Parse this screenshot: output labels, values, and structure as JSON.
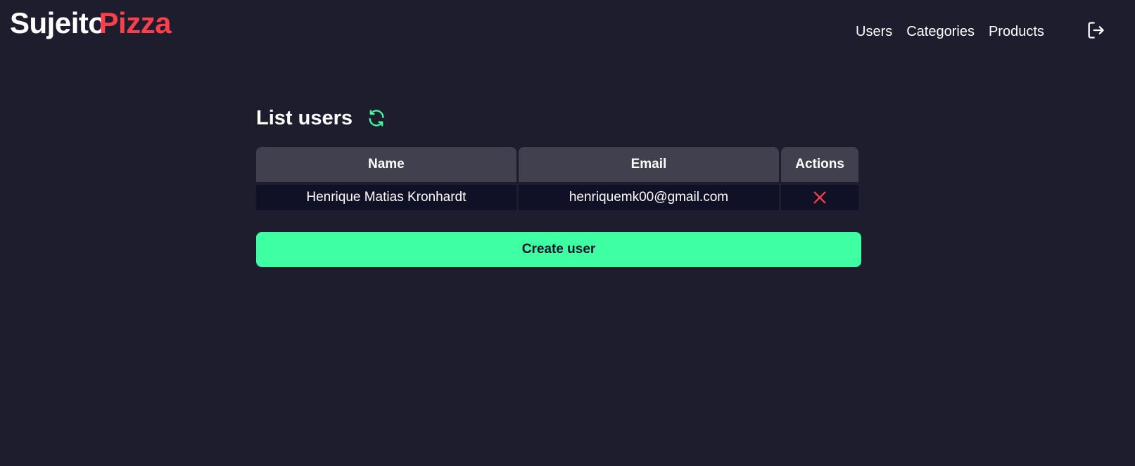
{
  "header": {
    "logo_part1": "Sujeito",
    "logo_part2": "Pizza",
    "nav": [
      {
        "label": "Users"
      },
      {
        "label": "Categories"
      },
      {
        "label": "Products"
      }
    ],
    "logout_icon": "logout-icon"
  },
  "main": {
    "title": "List users",
    "refresh_icon": "refresh-icon",
    "table": {
      "columns": [
        "Name",
        "Email",
        "Actions"
      ],
      "rows": [
        {
          "name": "Henrique Matias Kronhardt",
          "email": "henriquemk00@gmail.com",
          "action_icon": "close-icon"
        }
      ]
    },
    "create_button": "Create user"
  },
  "colors": {
    "background": "#1e1d2d",
    "brand_red": "#ff3f4b",
    "accent_green": "#3fffa3",
    "table_header": "#40404f",
    "table_row": "#101026"
  }
}
